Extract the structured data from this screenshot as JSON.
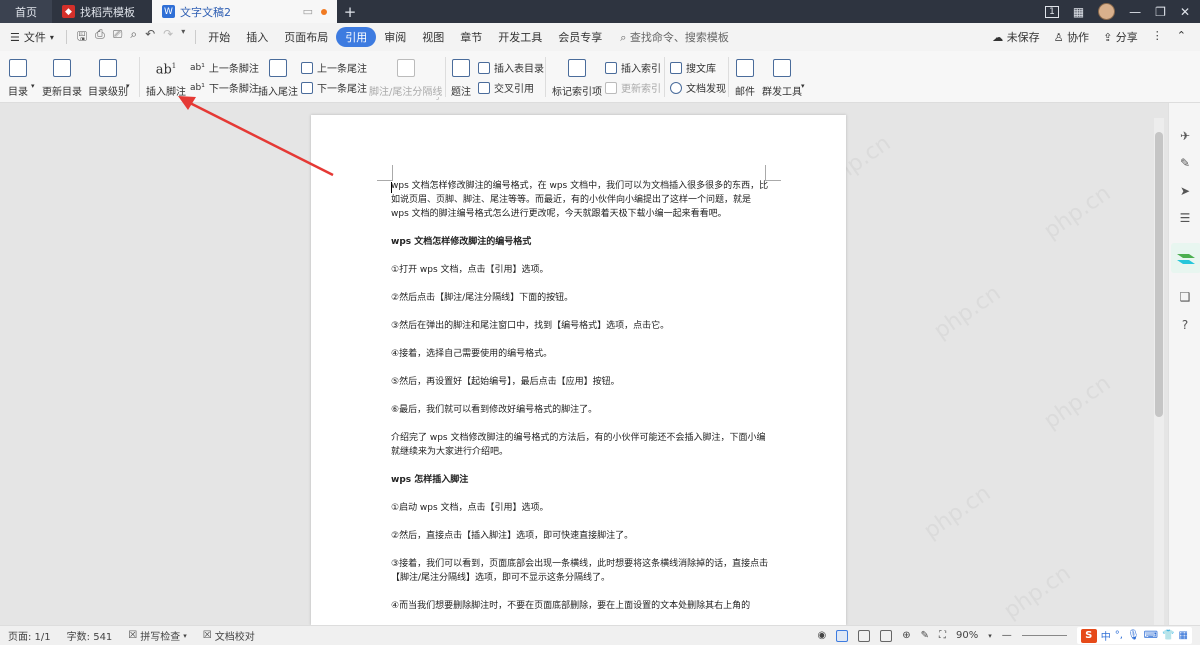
{
  "titlebar": {
    "home_tab": "首页",
    "template_tab": "找稻壳模板",
    "doc_tab": "文字文稿2",
    "new_tab": "+",
    "page_count_icon": "1",
    "window_controls": [
      "—",
      "❐",
      "✕"
    ]
  },
  "menubar": {
    "file": "文件",
    "items": [
      "开始",
      "插入",
      "页面布局",
      "引用",
      "审阅",
      "视图",
      "章节",
      "开发工具",
      "会员专享"
    ],
    "active_index": 3,
    "search_placeholder": "查找命令、搜索模板",
    "unsaved": "未保存",
    "collaborate": "协作",
    "share": "分享"
  },
  "ribbon": {
    "toc": "目录",
    "update_toc": "更新目录",
    "toc_level": "目录级别",
    "insert_footnote": "插入脚注",
    "prev_footnote": "上一条脚注",
    "next_footnote": "下一条脚注",
    "insert_endnote": "插入尾注",
    "prev_endnote": "上一条尾注",
    "next_endnote": "下一条尾注",
    "separator": "脚注/尾注分隔线",
    "caption": "题注",
    "insert_table_of_figures": "插入表目录",
    "cross_reference": "交叉引用",
    "mark_index_entry": "标记索引项",
    "insert_index": "插入索引",
    "update_index": "更新索引",
    "search_library": "搜文库",
    "doc_discovery": "文档发现",
    "mail": "邮件",
    "mass_tools": "群发工具"
  },
  "document": {
    "paragraphs": [
      {
        "text": "wps 文档怎样修改脚注的编号格式，在 wps 文档中，我们可以为文档插入很多很多的东西，比如说页眉、页脚、脚注、尾注等等。而最近，有的小伙伴向小编提出了这样一个问题，就是 wps 文档的脚注编号格式怎么进行更改呢，今天就跟着天极下载小编一起来看看吧。",
        "heading": false
      },
      {
        "text": "wps 文档怎样修改脚注的编号格式",
        "heading": true
      },
      {
        "text": "①打开 wps 文档，点击【引用】选项。",
        "heading": false
      },
      {
        "text": "②然后点击【脚注/尾注分隔线】下面的按钮。",
        "heading": false
      },
      {
        "text": "③然后在弹出的脚注和尾注窗口中，找到【编号格式】选项，点击它。",
        "heading": false
      },
      {
        "text": "④接着，选择自己需要使用的编号格式。",
        "heading": false
      },
      {
        "text": "⑤然后，再设置好【起始编号】，最后点击【应用】按钮。",
        "heading": false
      },
      {
        "text": "⑥最后，我们就可以看到修改好编号格式的脚注了。",
        "heading": false
      },
      {
        "text": "介绍完了 wps 文档修改脚注的编号格式的方法后，有的小伙伴可能还不会插入脚注，下面小编就继续来为大家进行介绍吧。",
        "heading": false
      },
      {
        "text": "wps 怎样插入脚注",
        "heading": true
      },
      {
        "text": "①启动 wps 文档，点击【引用】选项。",
        "heading": false
      },
      {
        "text": "②然后，直接点击【插入脚注】选项，即可快速直接脚注了。",
        "heading": false
      },
      {
        "text": "③接着，我们可以看到，页面底部会出现一条横线，此时想要将这条横线消除掉的话，直接点击【脚注/尾注分隔线】选项，即可不显示这条分隔线了。",
        "heading": false
      },
      {
        "text": "④而当我们想要删除脚注时，不要在页面底部删除，要在上面设置的文本处删除其右上角的",
        "heading": false
      }
    ]
  },
  "statusbar": {
    "page": "页面: 1/1",
    "words": "字数: 541",
    "spellcheck": "拼写检查",
    "proofread": "文档校对",
    "zoom": "90%",
    "ime_s": "S",
    "ime_lang": "中",
    "ime_punct": "°,",
    "ime_mic": "🎙"
  },
  "watermark": "php.cn",
  "colors": {
    "accent": "#3d7be0",
    "titlebar": "#2e3440",
    "arrow": "#e53935"
  }
}
